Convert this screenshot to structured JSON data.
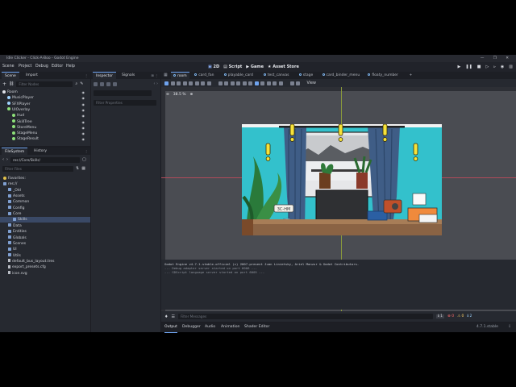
{
  "window": {
    "title": "Idle Clicker - Click-A-Boo - Godot Engine",
    "controls": "— ❐ ✕"
  },
  "menu": {
    "items": [
      "Scene",
      "Project",
      "Debug",
      "Editor",
      "Help"
    ]
  },
  "workspaces": {
    "2d": "2D",
    "script": "Script",
    "game": "Game",
    "asset_store": "Asset Store"
  },
  "scene_dock": {
    "tabs": [
      "Scene",
      "Import"
    ],
    "filter_placeholder": "Filter Nodes",
    "nodes": [
      {
        "label": "Room",
        "depth": 0,
        "color": "#e0e3ea"
      },
      {
        "label": "MusicPlayer",
        "depth": 1,
        "color": "#9fd3ff"
      },
      {
        "label": "SFXPlayer",
        "depth": 1,
        "color": "#9fd3ff"
      },
      {
        "label": "UIOverlay",
        "depth": 1,
        "color": "#8ee07a"
      },
      {
        "label": "Hud",
        "depth": 2,
        "color": "#8ee07a"
      },
      {
        "label": "SkillTree",
        "depth": 2,
        "color": "#8ee07a"
      },
      {
        "label": "StoreMenu",
        "depth": 2,
        "color": "#8ee07a"
      },
      {
        "label": "StageMenu",
        "depth": 2,
        "color": "#8ee07a"
      },
      {
        "label": "StageResult",
        "depth": 2,
        "color": "#8ee07a"
      }
    ]
  },
  "filesystem": {
    "tabs": [
      "FileSystem",
      "History"
    ],
    "path": "res://Core/Skills/",
    "filter_placeholder": "Filter Files",
    "items": [
      {
        "label": "Favorites:",
        "depth": 0,
        "kind": "fav"
      },
      {
        "label": "res://",
        "depth": 0,
        "kind": "folder"
      },
      {
        "label": "_Old",
        "depth": 1,
        "kind": "folder"
      },
      {
        "label": "Assets",
        "depth": 1,
        "kind": "folder"
      },
      {
        "label": "Common",
        "depth": 1,
        "kind": "folder"
      },
      {
        "label": "Config",
        "depth": 1,
        "kind": "folder"
      },
      {
        "label": "Core",
        "depth": 1,
        "kind": "folder"
      },
      {
        "label": "Skills",
        "depth": 2,
        "kind": "folder",
        "selected": true
      },
      {
        "label": "Data",
        "depth": 1,
        "kind": "folder"
      },
      {
        "label": "Entities",
        "depth": 1,
        "kind": "folder"
      },
      {
        "label": "Globals",
        "depth": 1,
        "kind": "folder"
      },
      {
        "label": "Scenes",
        "depth": 1,
        "kind": "folder"
      },
      {
        "label": "UI",
        "depth": 1,
        "kind": "folder"
      },
      {
        "label": "Utils",
        "depth": 1,
        "kind": "folder"
      },
      {
        "label": "default_bus_layout.tres",
        "depth": 1,
        "kind": "file"
      },
      {
        "label": "export_presets.cfg",
        "depth": 1,
        "kind": "file"
      },
      {
        "label": "icon.svg",
        "depth": 1,
        "kind": "file"
      }
    ]
  },
  "inspector": {
    "tabs": [
      "Inspector",
      "Signals"
    ],
    "filter_placeholder": "Filter Properties"
  },
  "editor_tabs": [
    {
      "label": "room",
      "active": true
    },
    {
      "label": "card_fan"
    },
    {
      "label": "playable_card"
    },
    {
      "label": "test_canvas"
    },
    {
      "label": "stage"
    },
    {
      "label": "card_binder_menu"
    },
    {
      "label": "floaty_number"
    }
  ],
  "viewport": {
    "zoom": "38.5 %",
    "view_label": "View"
  },
  "scene_art": {
    "sign_text": "3C-HM"
  },
  "output": {
    "lines": [
      "Godot Engine v4.7.1.stable.official (c) 2007-present Juan Linietsky, Ariel Manzur & Godot Contributors.",
      "--- Debug adapter server started on port 6006 ---",
      "--- GDScript language server started on port 6005 ---"
    ],
    "filter_placeholder": "Filter Messages",
    "counts": [
      "1",
      "0",
      "0",
      "2"
    ]
  },
  "bottom_tabs": [
    "Output",
    "Debugger",
    "Audio",
    "Animation",
    "Shader Editor"
  ],
  "version": "4.7.1.stable",
  "colors": {
    "accent": "#6fa3ee",
    "bg": "#1c1d23",
    "panel": "#262930"
  }
}
